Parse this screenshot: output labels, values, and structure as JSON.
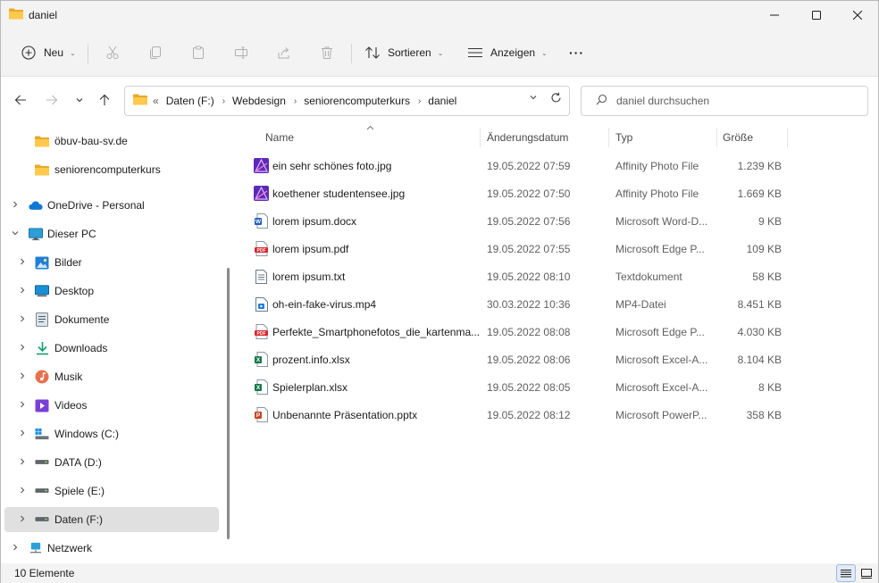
{
  "window": {
    "title": "daniel",
    "accent": "#0067c0"
  },
  "commandbar": {
    "new_label": "Neu",
    "sort_label": "Sortieren",
    "view_label": "Anzeigen",
    "more_label": "···",
    "icons": [
      "plus-circle-icon",
      "cut-icon",
      "copy-icon",
      "paste-icon",
      "rename-icon",
      "share-icon",
      "delete-icon",
      "sort-icon",
      "view-icon"
    ]
  },
  "address": {
    "overflow": "«",
    "crumbs": [
      "Daten (F:)",
      "Webdesign",
      "seniorencomputerkurs",
      "daniel"
    ]
  },
  "search": {
    "placeholder": "daniel durchsuchen"
  },
  "navpane": {
    "items": [
      {
        "label": "öbuv-bau-sv.de",
        "icon": "folder-icon",
        "level": 2,
        "expander": ""
      },
      {
        "label": "seniorencomputerkurs",
        "icon": "folder-icon",
        "level": 2,
        "expander": ""
      },
      {
        "label": "OneDrive - Personal",
        "icon": "onedrive-icon",
        "level": 1,
        "expander": "›"
      },
      {
        "label": "Dieser PC",
        "icon": "pc-icon",
        "level": 1,
        "expander": "⌄"
      },
      {
        "label": "Bilder",
        "icon": "pictures-icon",
        "level": 2,
        "expander": "›"
      },
      {
        "label": "Desktop",
        "icon": "desktop-icon",
        "level": 2,
        "expander": "›"
      },
      {
        "label": "Dokumente",
        "icon": "documents-icon",
        "level": 2,
        "expander": "›"
      },
      {
        "label": "Downloads",
        "icon": "downloads-icon",
        "level": 2,
        "expander": "›"
      },
      {
        "label": "Musik",
        "icon": "music-icon",
        "level": 2,
        "expander": "›"
      },
      {
        "label": "Videos",
        "icon": "videos-icon",
        "level": 2,
        "expander": "›"
      },
      {
        "label": "Windows (C:)",
        "icon": "windows-drive-icon",
        "level": 2,
        "expander": "›"
      },
      {
        "label": "DATA (D:)",
        "icon": "drive-icon",
        "level": 2,
        "expander": "›"
      },
      {
        "label": "Spiele (E:)",
        "icon": "drive-icon",
        "level": 2,
        "expander": "›"
      },
      {
        "label": "Daten (F:)",
        "icon": "drive-icon",
        "level": 2,
        "expander": "›",
        "selected": true
      },
      {
        "label": "Netzwerk",
        "icon": "network-icon",
        "level": 1,
        "expander": "›"
      }
    ]
  },
  "filelist": {
    "columns": {
      "name": "Name",
      "date": "Änderungsdatum",
      "type": "Typ",
      "size": "Größe"
    },
    "rows": [
      {
        "name": "ein sehr schönes foto.jpg",
        "date": "19.05.2022 07:59",
        "type": "Affinity Photo File",
        "size": "1.239 KB",
        "icon": "affinity-photo-icon"
      },
      {
        "name": "koethener studentensee.jpg",
        "date": "19.05.2022 07:50",
        "type": "Affinity Photo File",
        "size": "1.669 KB",
        "icon": "affinity-photo-icon"
      },
      {
        "name": "lorem ipsum.docx",
        "date": "19.05.2022 07:56",
        "type": "Microsoft Word-D...",
        "size": "9 KB",
        "icon": "word-icon"
      },
      {
        "name": "lorem ipsum.pdf",
        "date": "19.05.2022 07:55",
        "type": "Microsoft Edge P...",
        "size": "109 KB",
        "icon": "pdf-icon"
      },
      {
        "name": "lorem ipsum.txt",
        "date": "19.05.2022 08:10",
        "type": "Textdokument",
        "size": "58 KB",
        "icon": "text-file-icon"
      },
      {
        "name": "oh-ein-fake-virus.mp4",
        "date": "30.03.2022 10:36",
        "type": "MP4-Datei",
        "size": "8.451 KB",
        "icon": "video-file-icon"
      },
      {
        "name": "Perfekte_Smartphonefotos_die_kartenma...",
        "date": "19.05.2022 08:08",
        "type": "Microsoft Edge P...",
        "size": "4.030 KB",
        "icon": "pdf-icon"
      },
      {
        "name": "prozent.info.xlsx",
        "date": "19.05.2022 08:06",
        "type": "Microsoft Excel-A...",
        "size": "8.104 KB",
        "icon": "excel-icon"
      },
      {
        "name": "Spielerplan.xlsx",
        "date": "19.05.2022 08:05",
        "type": "Microsoft Excel-A...",
        "size": "8 KB",
        "icon": "excel-icon"
      },
      {
        "name": "Unbenannte Präsentation.pptx",
        "date": "19.05.2022 08:12",
        "type": "Microsoft PowerP...",
        "size": "358 KB",
        "icon": "powerpoint-icon"
      }
    ]
  },
  "status": {
    "count_text": "10 Elemente"
  }
}
